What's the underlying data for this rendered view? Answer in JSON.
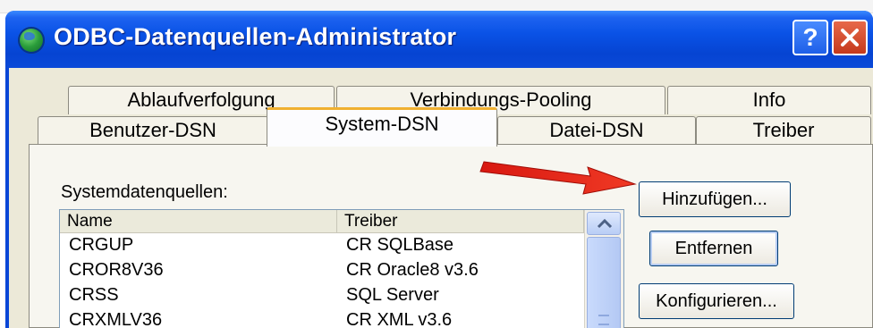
{
  "window": {
    "title": "ODBC-Datenquellen-Administrator",
    "help_glyph": "?",
    "icon": "globe-icon"
  },
  "tabs_back": [
    {
      "label": "Ablaufverfolgung"
    },
    {
      "label": "Verbindungs-Pooling"
    },
    {
      "label": "Info"
    }
  ],
  "tabs_front": [
    {
      "label": "Benutzer-DSN"
    },
    {
      "label": "System-DSN",
      "active": true
    },
    {
      "label": "Datei-DSN"
    },
    {
      "label": "Treiber"
    }
  ],
  "panel": {
    "label": "Systemdatenquellen:",
    "columns": [
      "Name",
      "Treiber"
    ],
    "rows": [
      {
        "name": "CRGUP",
        "driver": "CR SQLBase"
      },
      {
        "name": "CROR8V36",
        "driver": "CR Oracle8 v3.6"
      },
      {
        "name": "CRSS",
        "driver": "SQL Server"
      },
      {
        "name": "CRXMLV36",
        "driver": "CR XML v3.6"
      }
    ]
  },
  "buttons": {
    "add": "Hinzufügen...",
    "remove": "Entfernen",
    "configure": "Konfigurieren..."
  },
  "colors": {
    "title_bar": "#0a52e6",
    "client": "#ece9d8",
    "annotation_arrow": "#e8201a",
    "active_tab_highlight": "#f0b030"
  }
}
